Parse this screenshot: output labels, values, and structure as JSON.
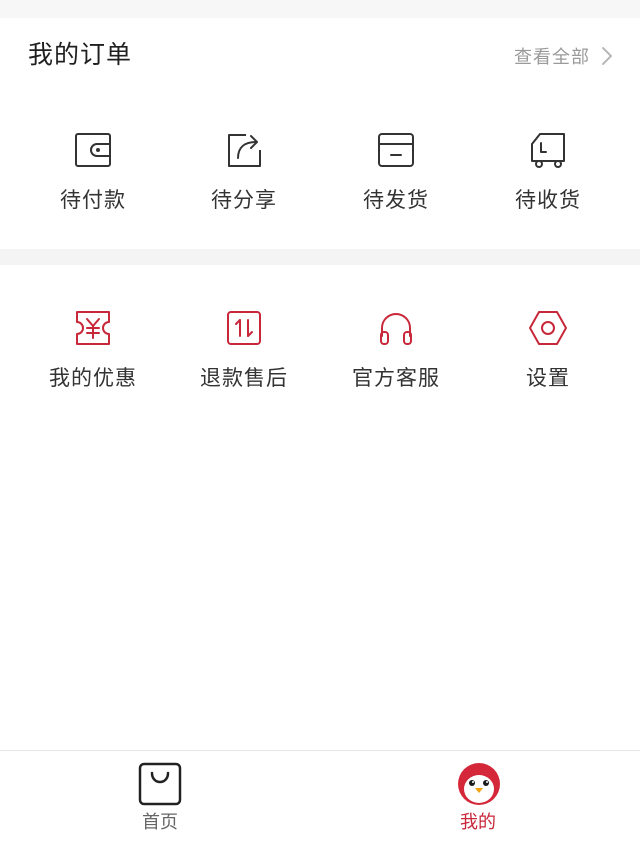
{
  "orders": {
    "title": "我的订单",
    "view_all": "查看全部",
    "items": [
      {
        "label": "待付款",
        "icon": "wallet-icon"
      },
      {
        "label": "待分享",
        "icon": "share-icon"
      },
      {
        "label": "待发货",
        "icon": "package-icon"
      },
      {
        "label": "待收货",
        "icon": "truck-icon"
      }
    ]
  },
  "services": {
    "items": [
      {
        "label": "我的优惠",
        "icon": "coupon-icon"
      },
      {
        "label": "退款售后",
        "icon": "refund-icon"
      },
      {
        "label": "官方客服",
        "icon": "headphones-icon"
      },
      {
        "label": "设置",
        "icon": "settings-icon"
      }
    ]
  },
  "tabbar": {
    "items": [
      {
        "label": "首页",
        "icon": "shopping-bag-icon",
        "active": false
      },
      {
        "label": "我的",
        "icon": "penguin-avatar-icon",
        "active": true
      }
    ]
  },
  "colors": {
    "accent": "#c8283a",
    "order_icon": "#333333",
    "service_icon": "#c8283a",
    "muted_text": "#9a9a9a",
    "divider": "#f4f4f4"
  }
}
